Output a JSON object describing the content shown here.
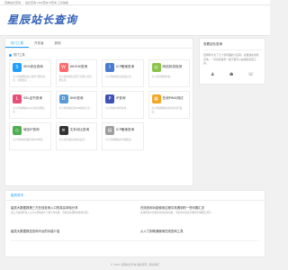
{
  "topbar": {
    "items": [
      "查看站长查询",
      "站长查询 CNS查询 IP查询 工具信箱"
    ]
  },
  "header": {
    "logo": "星辰站长查询"
  },
  "tabs": [
    {
      "label": "热门工具"
    },
    {
      "label": "开发者"
    },
    {
      "label": "其他"
    }
  ],
  "section": {
    "label": "热门工具"
  },
  "tools": [
    {
      "name": "SEO综合查询",
      "desc": "可以查询网站各大搜索引擎的信息，包括收录、...",
      "color": "#1e9fff",
      "icon": "S"
    },
    {
      "name": "WHOIS查询",
      "desc": "可以查询域名是否已注册以及注册信息...",
      "color": "#ff6b6b",
      "icon": "W"
    },
    {
      "name": "ICP备案查询",
      "desc": "可以查询域名的备案信息...",
      "color": "#4a7bd0",
      "icon": "I"
    },
    {
      "name": "网站状态检测",
      "desc": "可以查询网站状态...",
      "color": "#8bc34a",
      "icon": "◎"
    },
    {
      "name": "SSL证书查询",
      "desc": "可以查询网站SSL证书的详细信息...",
      "color": "#e94e77",
      "icon": "L"
    },
    {
      "name": "DNS查询",
      "desc": "可以查询域名的DNS解析记录...",
      "color": "#5b9bd5",
      "icon": "D"
    },
    {
      "name": "IP查询",
      "desc": "可以查询IP的所在地...",
      "color": "#3f51b5",
      "icon": "P"
    },
    {
      "name": "在线PING测试",
      "desc": "可以测试网站在各地的访问速度...",
      "color": "#f5a623",
      "icon": "▦"
    },
    {
      "name": "域名IP查询",
      "desc": "可以查询域名解析到的IP地址...",
      "color": "#4caf50",
      "icon": "◇"
    },
    {
      "name": "文本对比查询",
      "desc": "可以对比两段文本的差异...",
      "color": "#333333",
      "icon": "≡"
    },
    {
      "name": "ICP备案查询",
      "desc": "可以查询网站的详细备案...",
      "color": "#9e9e9e",
      "icon": "▤"
    }
  ],
  "side": {
    "title": "查看站长查询",
    "desc": "四朝科为文了几十款有趣的小应用，就遭遇在线者查询，一查就找遇查一截不要可以在线的实用工具。"
  },
  "bottom": {
    "head": "星辰资讯"
  },
  "news": [
    {
      "title": "星辰大数据报第三方在线查询入口的真实体验分享",
      "desc": "第三方在线查询入口可以帮助用户了解平台功能，带来更多便利的体验过程..."
    },
    {
      "title": "在线查询功能使用过程中常遇到的一些问题汇总",
      "desc": "在线查询平台提供多种实用功能，带给用户更多方便的查询服务过程..."
    },
    {
      "title": "星辰大数据报告查询平台的功能介绍",
      "desc": ""
    },
    {
      "title": "从入门到精通使用在线查询工具",
      "desc": ""
    }
  ],
  "footer": "© 2021 星辰站长查询 版权所有 | 联系我们"
}
